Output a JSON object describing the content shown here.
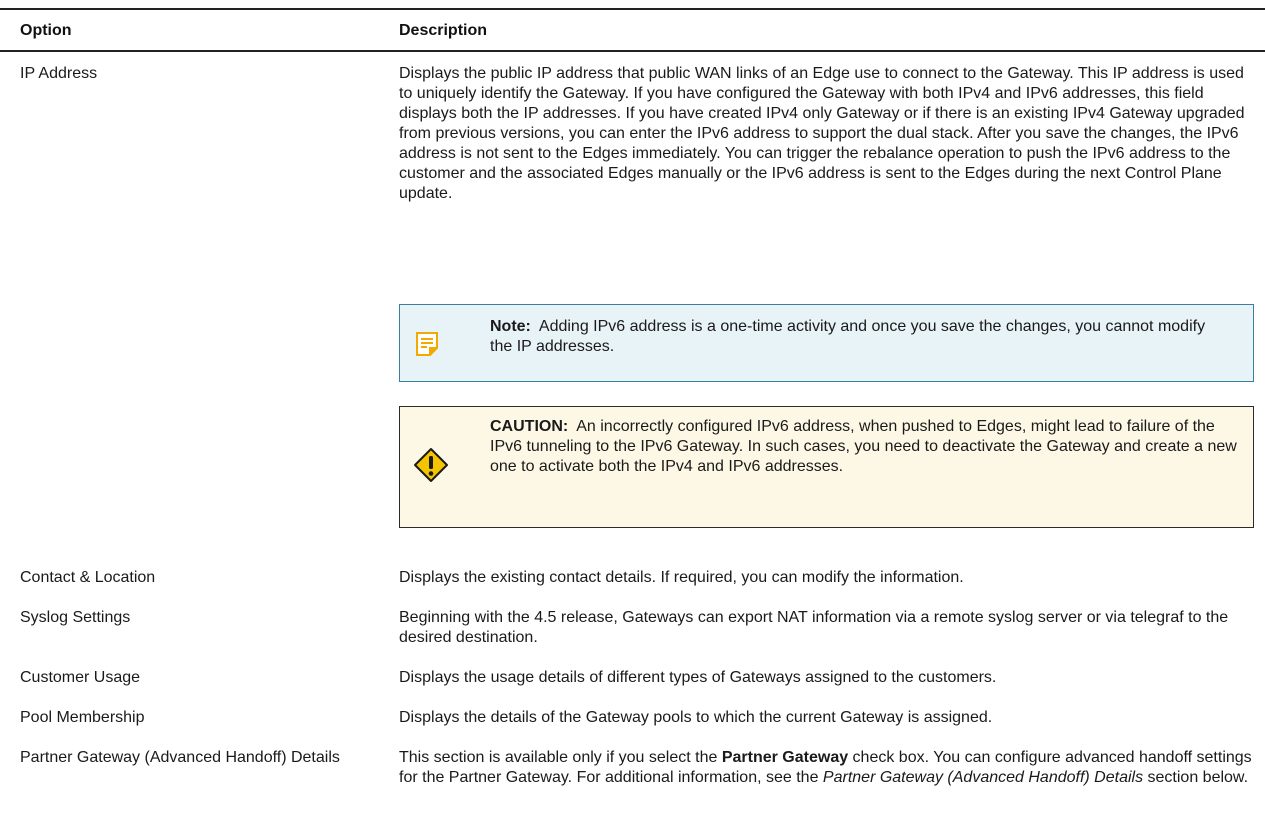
{
  "table": {
    "header": {
      "option": "Option",
      "description": "Description"
    },
    "rows": [
      {
        "option": "IP Address",
        "description": "Displays the public IP address that public WAN links of an Edge use to connect to the Gateway. This IP address is used to uniquely identify the Gateway. If you have configured the Gateway with both IPv4 and IPv6 addresses, this field displays both the IP addresses. If you have created IPv4 only Gateway or if there is an existing IPv4 Gateway upgraded from previous versions, you can enter the IPv6 address to support the dual stack. After you save the changes, the IPv6 address is not sent to the Edges immediately. You can trigger the rebalance operation to push the IPv6 address to the customer and the associated Edges manually or the IPv6 address is sent to the Edges during the next Control Plane update.",
        "note": {
          "label": "Note:",
          "text": "Adding IPv6 address is a one-time activity and once you save the changes, you cannot modify the IP addresses.",
          "icon": "note-icon"
        },
        "caution": {
          "label": "CAUTION:",
          "text": "An incorrectly configured IPv6 address, when pushed to Edges, might lead to failure of the IPv6 tunneling to the IPv6 Gateway. In such cases, you need to deactivate the Gateway and create a new one to activate both the IPv4 and IPv6 addresses.",
          "icon": "caution-icon"
        }
      },
      {
        "option": "Contact & Location",
        "description": "Displays the existing contact details. If required, you can modify the information."
      },
      {
        "option": "Syslog Settings",
        "description": "Beginning with the 4.5 release, Gateways can export NAT information via a remote syslog server or via telegraf to the desired destination."
      },
      {
        "option": "Customer Usage",
        "description": "Displays the usage details of different types of Gateways assigned to the customers."
      },
      {
        "option": "Pool Membership",
        "description": "Displays the details of the Gateway pools to which the current Gateway is assigned."
      },
      {
        "option": "Partner Gateway (Advanced Handoff) Details",
        "description_parts": {
          "p1": "This section is available only if you select the ",
          "bold": "Partner Gateway",
          "p2": " check box. You can configure advanced handoff settings for the Partner Gateway. For additional information, see the ",
          "italic": "Partner Gateway (Advanced Handoff) Details",
          "p3": " section below."
        }
      }
    ]
  },
  "colors": {
    "note_bg": "#e8f3f8",
    "note_border": "#3b7ea1",
    "note_icon": "#f2a900",
    "caution_bg": "#fdf8e6",
    "caution_border": "#2b2b2b",
    "caution_icon": "#f5c400"
  }
}
